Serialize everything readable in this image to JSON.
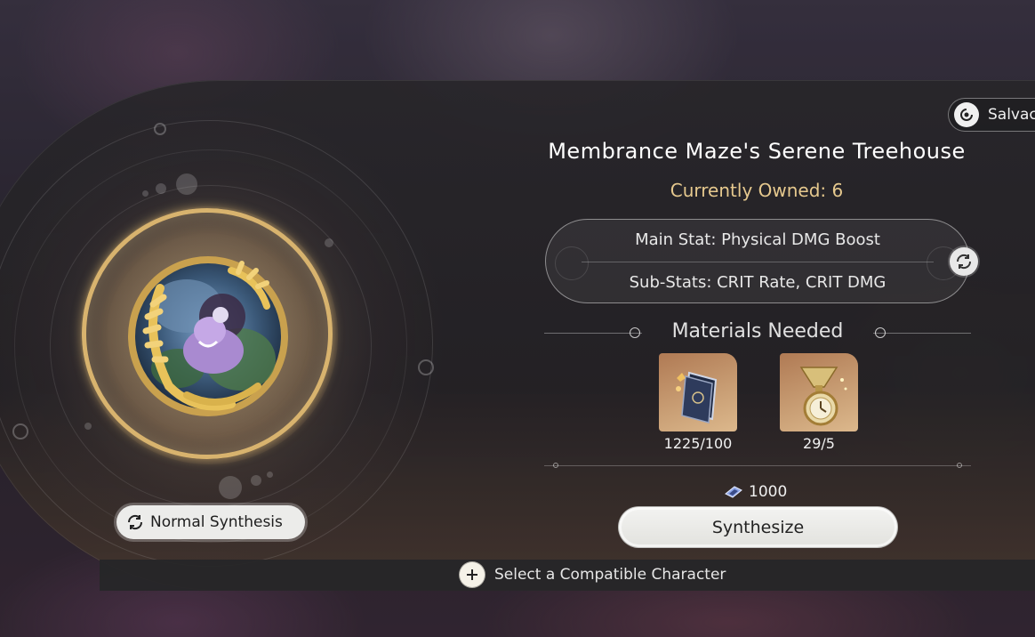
{
  "relic": {
    "name": "Membrance Maze's Serene Treehouse",
    "owned_label": "Currently Owned: 6"
  },
  "stats": {
    "main": "Main Stat: Physical DMG Boost",
    "sub": "Sub-Stats: CRIT Rate, CRIT DMG"
  },
  "materials": {
    "header": "Materials Needed",
    "items": [
      {
        "icon": "book-icon",
        "count": "1225/100"
      },
      {
        "icon": "pocket-watch-icon",
        "count": "29/5"
      }
    ]
  },
  "cost": {
    "icon": "credit-icon",
    "amount": "1000"
  },
  "buttons": {
    "synthesize": "Synthesize",
    "normal_synthesis": "Normal Synthesis",
    "salvage": "Salvac"
  },
  "footer": {
    "hint": "Select a Compatible Character"
  },
  "colors": {
    "owned": "#e6c98e",
    "medal_gold": "#d8b36e",
    "button_bg": "#ececea"
  }
}
